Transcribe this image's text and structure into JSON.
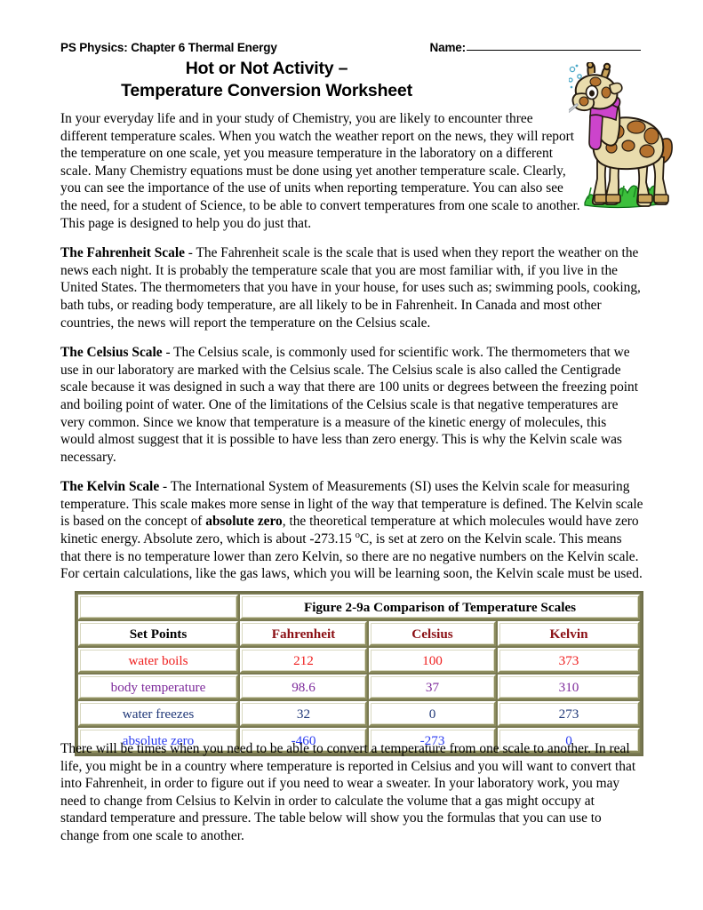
{
  "header": {
    "course_line": "PS Physics:  Chapter 6 Thermal Energy",
    "name_label": "Name:"
  },
  "title": {
    "line1": "Hot or Not Activity –",
    "line2": "Temperature Conversion Worksheet"
  },
  "clipart": {
    "alt": "giraffe-with-thermometer-and-scarf",
    "body_color": "#e9dcad",
    "spot_color": "#b5722e",
    "scarf_color": "#cc44cc",
    "grass_color": "#3cbf3c"
  },
  "paragraphs": {
    "intro": "In your everyday life and in your study of Chemistry, you are likely to encounter three different temperature scales.  When you watch the weather report on the news, they will report the temperature on one scale, yet you measure temperature in the laboratory on a different scale.  Many Chemistry equations must be done using yet another temperature scale.  Clearly, you can see the importance of the use of units when reporting temperature.  You can also see the need, for a student of Science, to be able to convert temperatures from one scale to another.  This page is designed to help you do just that.",
    "fahrenheit_heading": "The Fahrenheit Scale",
    "fahrenheit_body": " - The Fahrenheit scale is the scale that is used when they report the weather on the news each night. It is probably the temperature scale that you are most familiar with, if you live in the United States.   The thermometers that you have in your house, for uses such as; swimming pools, cooking, bath tubs, or reading body temperature, are all likely to be in Fahrenheit.   In Canada and most other countries, the news will report the temperature on the Celsius scale.",
    "celsius_heading": "The Celsius Scale",
    "celsius_body": " - The Celsius scale, is commonly used for scientific work.  The thermometers that we use in our laboratory are marked with the Celsius scale.  The Celsius scale is also called the Centigrade scale because it was designed in such a way that there are 100 units or degrees between the freezing point and boiling point of water.  One of the limitations of the Celsius scale is that negative temperatures are very common.  Since we know that temperature is a measure of the kinetic energy of molecules, this would almost suggest that it is possible to have less than zero energy.   This is why the Kelvin scale was necessary.",
    "kelvin_heading": "The Kelvin Scale",
    "kelvin_part1": " - The International System of Measurements (SI) uses the Kelvin scale for measuring temperature.  This scale makes more sense in light of the way that temperature is defined.  The Kelvin scale is based on the concept of ",
    "kelvin_bold_term": "absolute zero",
    "kelvin_part2": ", the theoretical temperature at which molecules would have zero kinetic energy.  Absolute zero, which is about -273.15 ",
    "kelvin_degree_symbol": "o",
    "kelvin_part3": "C, is set at zero on the Kelvin scale.  This means that there is no temperature lower than zero Kelvin, so there are no negative numbers on the Kelvin scale.  For certain calculations, like the gas laws, which you will be learning soon, the Kelvin scale must be used.",
    "closing": "There will be times when you need to be able to convert a temperature from one scale to another.  In real life, you might be in a country where temperature is reported in Celsius and you will want to convert that into Fahrenheit, in order to figure out if you need to wear a sweater.  In your laboratory work, you may need to change from Celsius to Kelvin in order to calculate the volume that a gas might occupy at standard temperature and pressure.  The table below will show you the formulas that you can use to change from one scale to another."
  },
  "table": {
    "figure_title": "Figure 2-9a Comparison of Temperature Scales",
    "swatch_color": "#7b0f0f",
    "headers": [
      "Set Points",
      "Fahrenheit",
      "Celsius",
      "Kelvin"
    ],
    "rows": [
      {
        "label": "water boils",
        "fahrenheit": "212",
        "celsius": "100",
        "kelvin": "373",
        "color": "#ef2020"
      },
      {
        "label": "body temperature",
        "fahrenheit": "98.6",
        "celsius": "37",
        "kelvin": "310",
        "color": "#7d2a9b"
      },
      {
        "label": "water freezes",
        "fahrenheit": "32",
        "celsius": "0",
        "kelvin": "273",
        "color": "#203878"
      },
      {
        "label": "absolute zero",
        "fahrenheit": "-460",
        "celsius": "-273",
        "kelvin": "0",
        "color": "#2b3cf0"
      }
    ]
  }
}
